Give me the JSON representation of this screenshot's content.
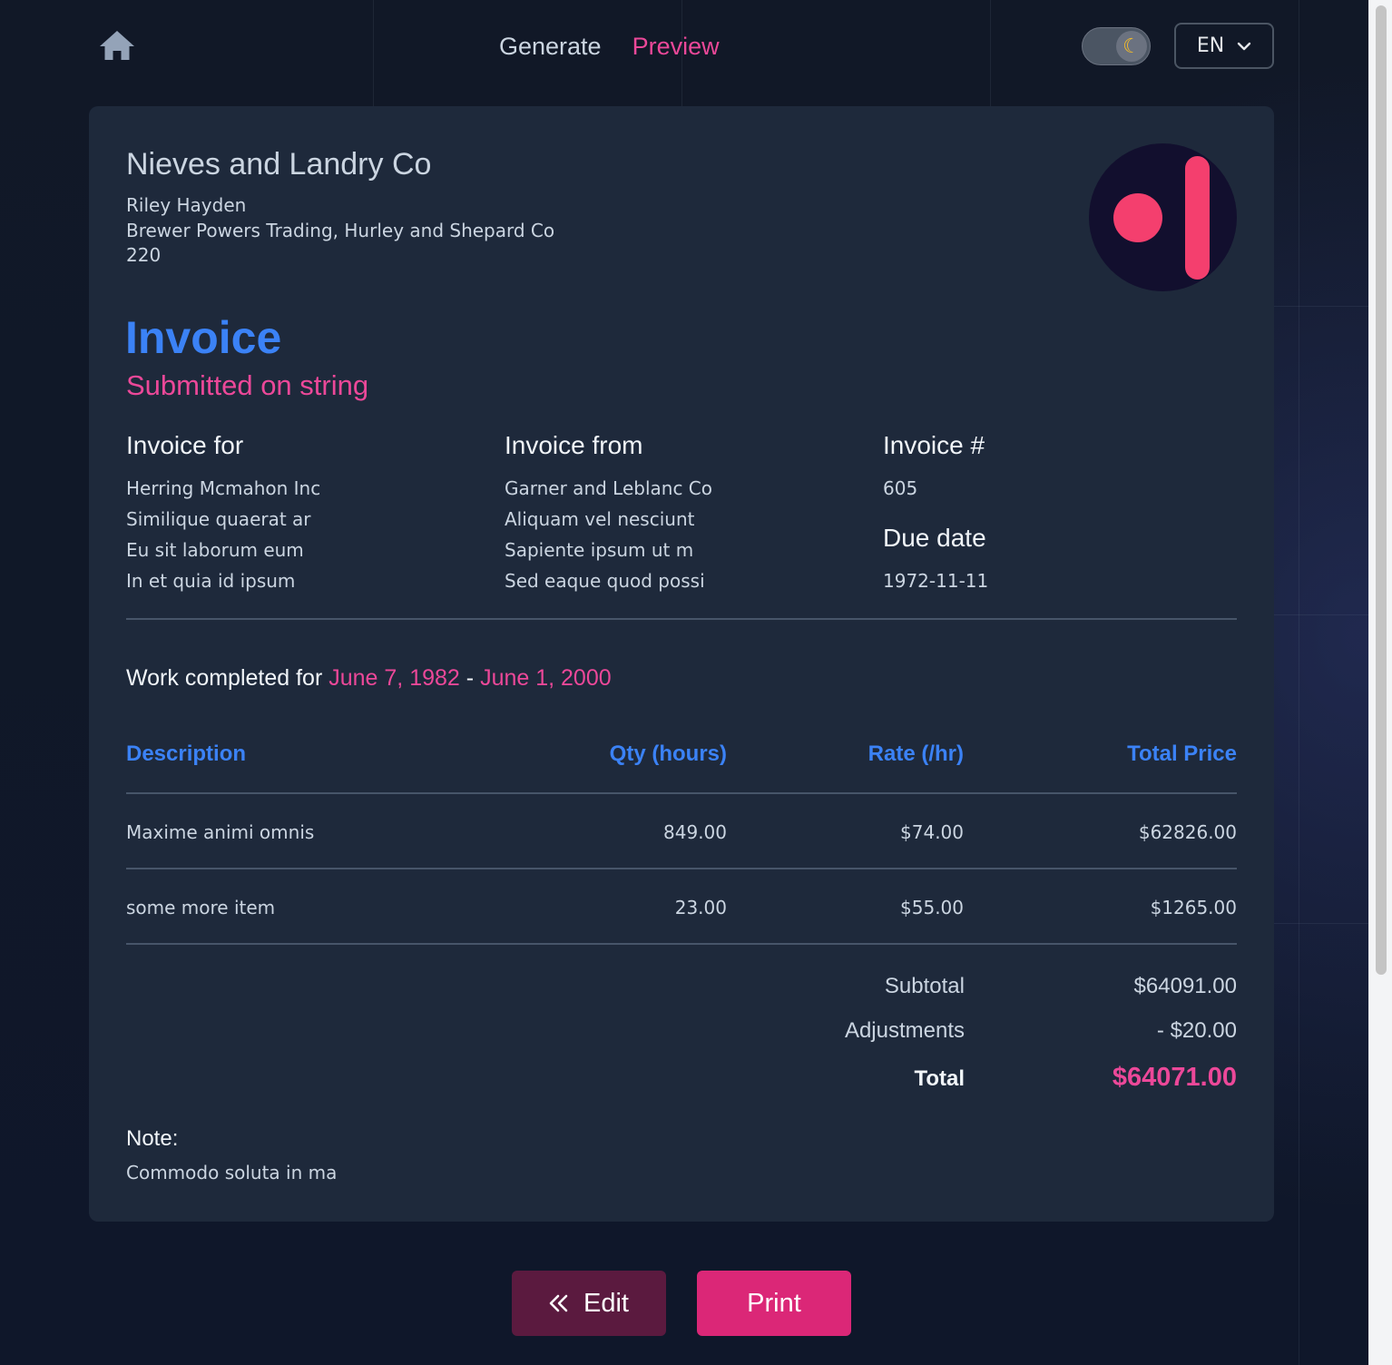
{
  "header": {
    "nav": {
      "generate": "Generate",
      "preview": "Preview"
    },
    "theme_icon": "moon-icon",
    "language": "EN"
  },
  "invoice": {
    "company_name": "Nieves and Landry Co",
    "sender": {
      "name": "Riley Hayden",
      "company": "Brewer Powers Trading, Hurley and Shepard Co",
      "number": "220"
    },
    "title": "Invoice",
    "submitted": "Submitted on string",
    "invoice_for": {
      "heading": "Invoice for",
      "lines": [
        "Herring Mcmahon Inc",
        "Similique quaerat ar",
        "Eu sit laborum eum",
        "In et quia id ipsum"
      ]
    },
    "invoice_from": {
      "heading": "Invoice from",
      "lines": [
        "Garner and Leblanc Co",
        "Aliquam vel nesciunt",
        "Sapiente ipsum ut m",
        "Sed eaque quod possi"
      ]
    },
    "invoice_number": {
      "heading": "Invoice #",
      "value": "605"
    },
    "due_date": {
      "heading": "Due date",
      "value": "1972-11-11"
    },
    "work": {
      "prefix": "Work completed for",
      "start": "June 7, 1982",
      "separator": "-",
      "end": "June 1, 2000"
    },
    "table": {
      "headers": [
        "Description",
        "Qty (hours)",
        "Rate (/hr)",
        "Total Price"
      ],
      "rows": [
        [
          "Maxime animi omnis",
          "849.00",
          "$74.00",
          "$62826.00"
        ],
        [
          "some more item",
          "23.00",
          "$55.00",
          "$1265.00"
        ]
      ]
    },
    "totals": {
      "subtotal_label": "Subtotal",
      "subtotal": "$64091.00",
      "adjustments_label": "Adjustments",
      "adjustments": "- $20.00",
      "total_label": "Total",
      "total": "$64071.00"
    },
    "note": {
      "label": "Note:",
      "text": "Commodo soluta in ma"
    }
  },
  "actions": {
    "edit": "Edit",
    "print": "Print"
  },
  "colors": {
    "accent_blue": "#3b82f6",
    "accent_pink": "#ec4899",
    "card": "#1e293b",
    "background": "#0f172a"
  }
}
